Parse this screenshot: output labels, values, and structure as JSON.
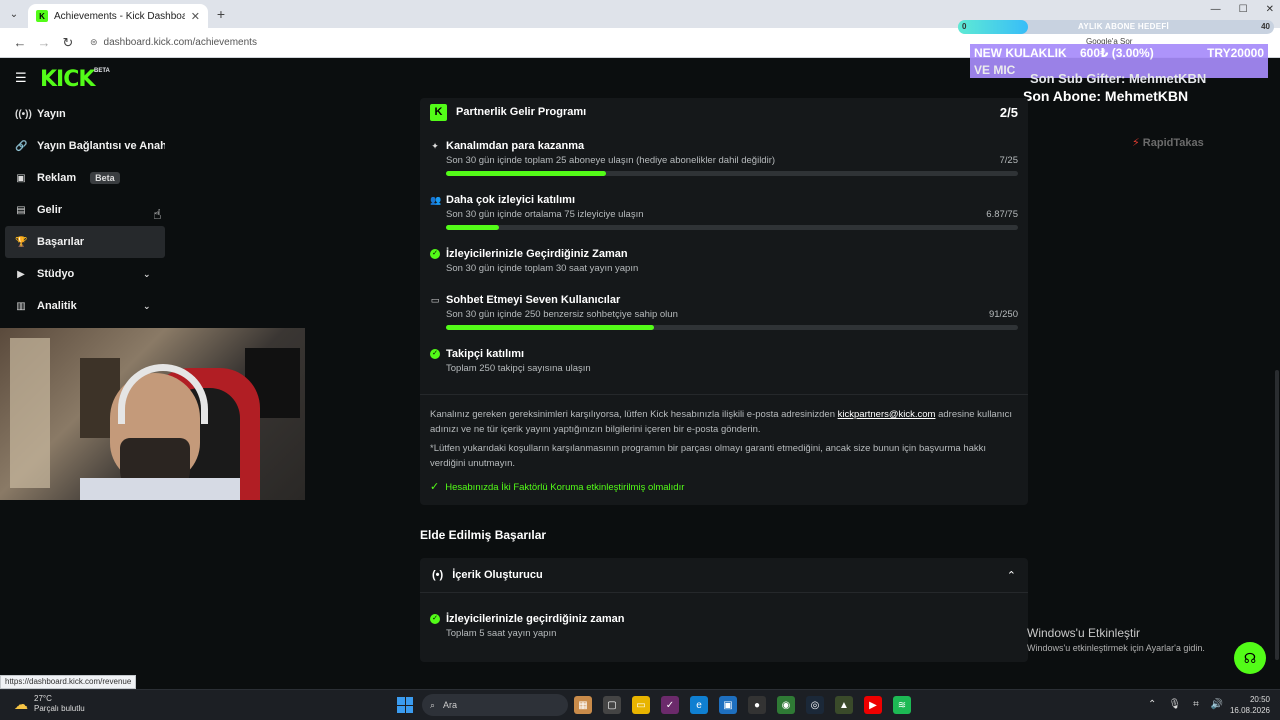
{
  "browser": {
    "tab_title": "Achievements - Kick Dashboard",
    "tab_close": "✕",
    "new_tab": "+",
    "url": "dashboard.kick.com/achievements",
    "window_controls": [
      "—",
      "☐",
      "✕"
    ]
  },
  "overlay": {
    "goal_left": "0",
    "goal_label": "AYLIK ABONE HEDEFİ",
    "goal_count": "40",
    "goal_progress": 0.22,
    "google_chip": "Google'a Sor",
    "announce_line1": "NEW KULAKLIK",
    "announce_line2": "VE MIC",
    "announce_pct": "600₺ (3.00%)",
    "announce_try": "TRY20000",
    "sub_gifter": "Son Sub Gifter: MehmetKBN",
    "son_abone": "Son Abone: MehmetKBN",
    "sponsor_pre": "⚡",
    "sponsor": "RapidTakas"
  },
  "kick": {
    "logo": "KICK",
    "beta": "BETA"
  },
  "sidebar": {
    "items": [
      {
        "icon": "((•))",
        "label": "Yayın",
        "chevron": ""
      },
      {
        "icon": "🔗",
        "label": "Yayın Bağlantısı ve Anahtarı",
        "chevron": ""
      },
      {
        "icon": "▣",
        "label": "Reklam",
        "badge": "Beta",
        "chevron": ""
      },
      {
        "icon": "▤",
        "label": "Gelir",
        "chevron": ""
      },
      {
        "icon": "🏆",
        "label": "Başarılar",
        "chevron": ""
      },
      {
        "icon": "▶",
        "label": "Stüdyo",
        "chevron": "⌄"
      },
      {
        "icon": "▥",
        "label": "Analitik",
        "chevron": "⌄"
      }
    ]
  },
  "partner": {
    "badge": "K",
    "title": "Partnerlik Gelir Programı",
    "count": "2/5",
    "requirements": [
      {
        "icon": "✦",
        "done": false,
        "title": "Kanalımdan para kazanma",
        "desc": "Son 30 gün içinde toplam 25 aboneye ulaşın (hediye abonelikler dahil değildir)",
        "value": "7/25",
        "progress": 0.28
      },
      {
        "icon": "👥",
        "done": false,
        "title": "Daha çok izleyici katılımı",
        "desc": "Son 30 gün içinde ortalama 75 izleyiciye ulaşın",
        "value": "6.87/75",
        "progress": 0.092
      },
      {
        "icon": "✓",
        "done": true,
        "title": "İzleyicilerinizle Geçirdiğiniz Zaman",
        "desc": "Son 30 gün içinde toplam 30 saat yayın yapın",
        "value": "",
        "progress": null
      },
      {
        "icon": "▭",
        "done": false,
        "title": "Sohbet Etmeyi Seven Kullanıcılar",
        "desc": "Son 30 gün içinde 250 benzersiz sohbetçiye sahip olun",
        "value": "91/250",
        "progress": 0.364
      },
      {
        "icon": "✓",
        "done": true,
        "title": "Takipçi katılımı",
        "desc": "Toplam 250 takipçi sayısına ulaşın",
        "value": "",
        "progress": null
      }
    ],
    "note1_pre": "Kanalınız gereken gereksinimleri karşılıyorsa, lütfen Kick hesabınızla ilişkili e-posta adresinizden ",
    "note1_link": "kickpartners@kick.com",
    "note1_post": " adresine kullanıcı adınızı ve ne tür içerik yayını yaptığınızın bilgilerini içeren bir e-posta gönderin.",
    "note2": "*Lütfen yukarıdaki koşulların karşılanmasının programın bir parçası olmayı garanti etmediğini, ancak size bunun için başvurma hakkı verdiğini unutmayın.",
    "twofa_check": "✓",
    "twofa": "Hesabınızda İki Faktörlü Koruma etkinleştirilmiş olmalıdır"
  },
  "earned": {
    "title": "Elde Edilmiş Başarılar",
    "section_icon": "(•)",
    "section": "İçerik Oluşturucu",
    "chevron": "⌃",
    "item_title": "İzleyicilerinizle geçirdiğiniz zaman",
    "item_desc": "Toplam 5 saat yayın yapın"
  },
  "windows": {
    "activate_title": "Windows'u Etkinleştir",
    "activate_desc": "Windows'u etkinleştirmek için Ayarlar'a gidin.",
    "status_url": "https://dashboard.kick.com/revenue",
    "weather_temp": "27°C",
    "weather_desc": "Parçalı bulutlu",
    "search": "Ara",
    "time": "20:50",
    "date": "16.08.2026"
  },
  "colors": {
    "kick_green": "#53fc18",
    "panel": "#15181a",
    "bg": "#0b0e0f"
  }
}
